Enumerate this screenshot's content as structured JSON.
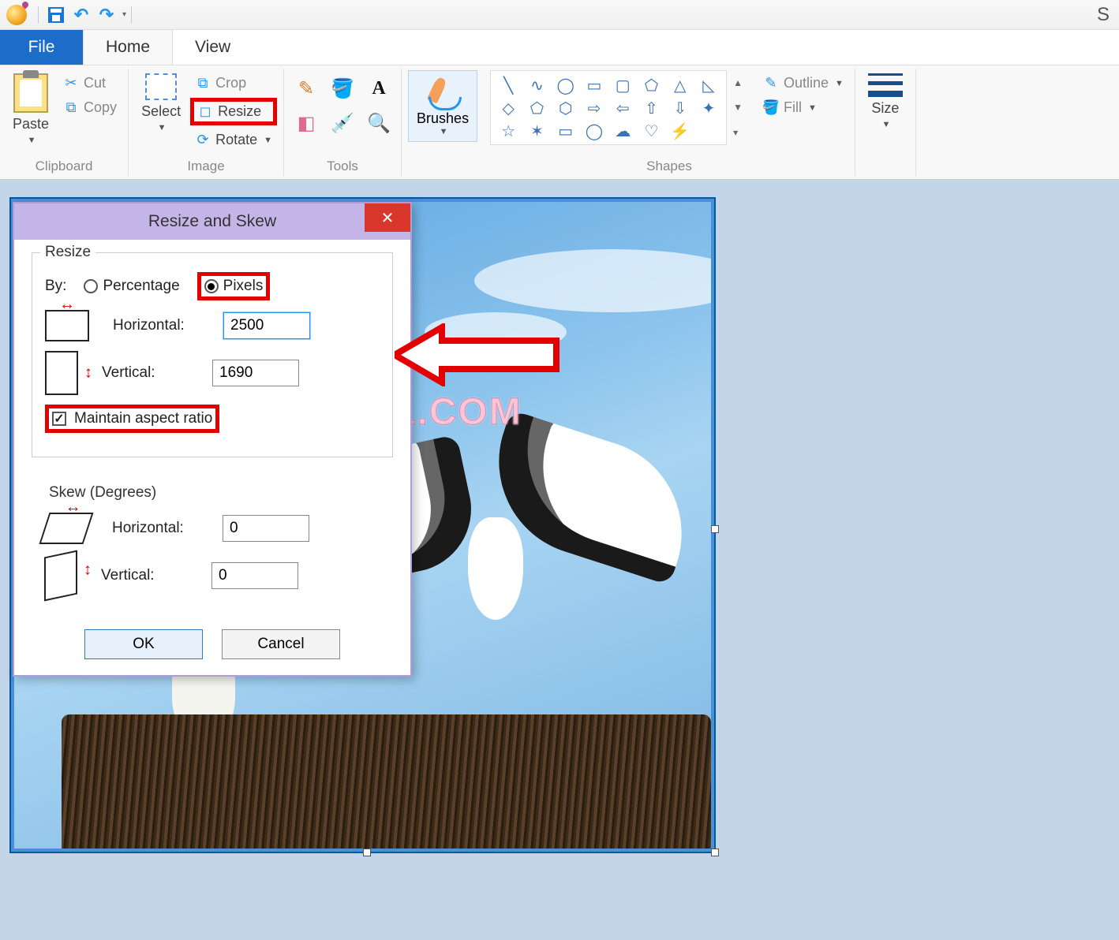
{
  "quick_access": {
    "save_tip": "Save",
    "undo_tip": "Undo",
    "redo_tip": "Redo"
  },
  "title_right": "S",
  "tabs": {
    "file": "File",
    "home": "Home",
    "view": "View"
  },
  "ribbon": {
    "clipboard": {
      "label": "Clipboard",
      "paste": "Paste",
      "cut": "Cut",
      "copy": "Copy"
    },
    "image": {
      "label": "Image",
      "select": "Select",
      "crop": "Crop",
      "resize": "Resize",
      "rotate": "Rotate"
    },
    "tools": {
      "label": "Tools"
    },
    "brushes": {
      "label": "Brushes"
    },
    "shapes": {
      "label": "Shapes",
      "outline": "Outline",
      "fill": "Fill"
    },
    "size": {
      "label": "Size"
    }
  },
  "dialog": {
    "title": "Resize and Skew",
    "resize": {
      "legend": "Resize",
      "by_label": "By:",
      "percentage": "Percentage",
      "pixels": "Pixels",
      "horizontal_label": "Horizontal:",
      "vertical_label": "Vertical:",
      "horizontal_value": "2500",
      "vertical_value": "1690",
      "maintain_aspect": "Maintain aspect ratio",
      "maintain_aspect_checked": true,
      "by_selected": "pixels"
    },
    "skew": {
      "legend": "Skew (Degrees)",
      "horizontal_label": "Horizontal:",
      "vertical_label": "Vertical:",
      "horizontal_value": "0",
      "vertical_value": "0"
    },
    "ok": "OK",
    "cancel": "Cancel",
    "close": "✕"
  },
  "watermark": "ZOTUTORIAL.COM"
}
